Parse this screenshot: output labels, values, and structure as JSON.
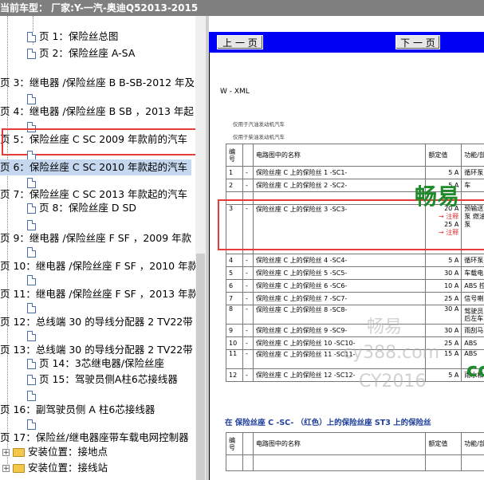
{
  "window": {
    "title": "当前车型：  厂家:Y-一汽-奥迪Q52013-2015"
  },
  "tree": {
    "items": [
      {
        "label": "页 1：保险丝总图",
        "type": "doc",
        "indent": 2
      },
      {
        "label": "页 2：保险丝座 A-SA",
        "type": "doc",
        "indent": 2
      },
      {
        "label": "页 3：继电器 /保险丝座 B B-SB-2012 年及",
        "type": "parent"
      },
      {
        "label": "",
        "type": "doc",
        "indent": 2
      },
      {
        "label": "页 4：继电器 /保险丝座 B SB ，2013 年起",
        "type": "parent"
      },
      {
        "label": "",
        "type": "doc",
        "indent": 2
      },
      {
        "label": "页 5：保险丝座 C SC 2009 年款前的汽车",
        "type": "parent"
      },
      {
        "label": "",
        "type": "doc",
        "indent": 2
      },
      {
        "label": "页 6：保险丝座 C SC 2010 年款起的汽车",
        "type": "parent",
        "selected": true
      },
      {
        "label": "",
        "type": "doc",
        "indent": 2
      },
      {
        "label": "页 7：保险丝座 C SC 2013 年款起的汽车",
        "type": "parent"
      },
      {
        "label": "页 8：保险丝座 D SD",
        "type": "doc",
        "indent": 2
      },
      {
        "label": "",
        "type": "doc",
        "indent": 2
      },
      {
        "label": "页 9：继电器 /保险丝座 F SF ，2009 年款",
        "type": "parent"
      },
      {
        "label": "",
        "type": "doc",
        "indent": 2
      },
      {
        "label": "页 10：继电器 /保险丝座 F SF ，2010 年款",
        "type": "parent"
      },
      {
        "label": "",
        "type": "doc",
        "indent": 2
      },
      {
        "label": "页 11：继电器 /保险丝座 F SF ，2013 年款",
        "type": "parent"
      },
      {
        "label": "",
        "type": "doc",
        "indent": 2
      },
      {
        "label": "页 12：总线端 30 的导线分配器 2 TV22带",
        "type": "parent"
      },
      {
        "label": "",
        "type": "doc",
        "indent": 2
      },
      {
        "label": "页 13：总线端 30 的导线分配器 2 TV22带",
        "type": "parent"
      },
      {
        "label": "页 14：3芯继电器/保险丝座",
        "type": "doc",
        "indent": 2
      },
      {
        "label": "页 15：驾驶员侧A柱6芯接线器",
        "type": "doc",
        "indent": 2
      },
      {
        "label": "",
        "type": "doc",
        "indent": 2
      },
      {
        "label": "页 16：副驾驶员侧 A 柱6芯接线器",
        "type": "parent"
      },
      {
        "label": "",
        "type": "doc",
        "indent": 2
      },
      {
        "label": "页 17：保险丝/继电器座带车载电网控制器",
        "type": "parent"
      },
      {
        "label": "安装位置：接地点",
        "type": "folder"
      },
      {
        "label": "安装位置：接线站",
        "type": "folder"
      }
    ]
  },
  "nav": {
    "prev_label": "上 一 页",
    "next_label": "下 一 页"
  },
  "doc": {
    "code": "W - XML",
    "line1": "仅用于汽油发动机汽车",
    "line2": "仅用于柴油发动机汽车",
    "headers": [
      "编号",
      "电路图中的名称",
      "额定值",
      "功能/部"
    ],
    "rows": [
      {
        "no": "1",
        "dash": "-",
        "name": "保险丝座 C 上的保险丝 1 -SC1-",
        "val": "5 A",
        "func": "循环泵"
      },
      {
        "no": "2",
        "dash": "-",
        "name": "保险丝座 C 上的保险丝 2 -SC2-",
        "val": "5 A",
        "func": "车"
      },
      {
        "no": "3",
        "dash": "-",
        "name": "保险丝座 C 上的保险丝 3 -SC3-",
        "val": "20 A",
        "val_note": "→ 注释",
        "val2": "25 A",
        "val_note2": "→ 注释",
        "func": "预输送泵 燃油泵"
      },
      {
        "no": "4",
        "dash": "-",
        "name": "保险丝座 C 上的保险丝 4 -SC4-",
        "val": "5 A",
        "func": "循环泵"
      },
      {
        "no": "5",
        "dash": "-",
        "name": "保险丝座 C 上的保险丝 5 -SC5-",
        "val": "30 A",
        "func": "车载电"
      },
      {
        "no": "6",
        "dash": "-",
        "name": "保险丝座 C 上的保险丝 6 -SC6-",
        "val": "10 A",
        "func": "ABS 控"
      },
      {
        "no": "7",
        "dash": "-",
        "name": "保险丝座 C 上的保险丝 7 -SC7-",
        "val": "25 A",
        "func": "信号喇"
      },
      {
        "no": "8",
        "dash": "-",
        "name": "保险丝座 C 上的保险丝 8 -SC8-",
        "val": "30 A",
        "func": "驾驶员 后左车"
      },
      {
        "no": "9",
        "dash": "-",
        "name": "保险丝座 C 上的保险丝 9 -SC9-",
        "val": "30 A",
        "func": "雨刮马"
      },
      {
        "no": "10",
        "dash": "-",
        "name": "保险丝座 C 上的保险丝 10 -SC10-",
        "val": "25 A",
        "func": "ABS"
      },
      {
        "no": "11",
        "dash": "-",
        "name": "保险丝座 C 上的保险丝 11 -SC11-",
        "val": "15 A",
        "func": "ABS"
      },
      {
        "no": "12",
        "dash": "-",
        "name": "保险丝座 C 上的保险丝 12 -SC12-",
        "val": "5 A",
        "func": "雨水和"
      }
    ],
    "heading2": "在 保险丝座 C -SC- （红色）上的保险丝座 ST3 上的保险丝",
    "headers2": [
      "编号",
      "电路图中的名称",
      "额定值",
      "功能/部"
    ]
  },
  "watermarks": {
    "wm1": "畅易",
    "wm2": "cy388.com",
    "wm3": "CY2016",
    "wm4": "畅易",
    "wm5": "co"
  },
  "colors": {
    "highlight_red": "#e53b3b",
    "nav_blue": "#0000f5",
    "selected": "#c6d8ef"
  }
}
